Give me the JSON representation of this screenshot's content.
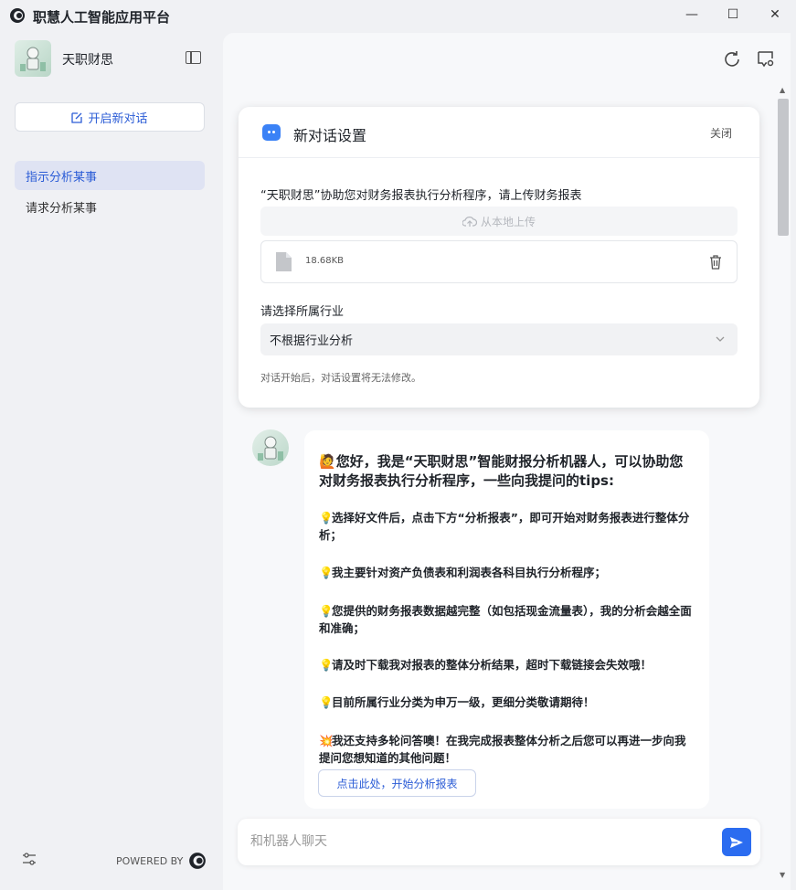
{
  "window": {
    "title": "职慧人工智能应用平台",
    "minimize_glyph": "—",
    "maximize_glyph": "☐",
    "close_glyph": "✕"
  },
  "sidebar": {
    "bot_name": "天职财思",
    "new_chat_label": "开启新对话",
    "items": [
      {
        "label": "指示分析某事",
        "active": true
      },
      {
        "label": "请求分析某事",
        "active": false
      }
    ],
    "powered_by": "POWERED BY"
  },
  "settings_card": {
    "title": "新对话设置",
    "close_label": "关闭",
    "upload_label": "“天职财思”协助您对财务报表执行分析程序，请上传财务报表",
    "upload_button": "从本地上传",
    "file_size": "18.68KB",
    "industry_label": "请选择所属行业",
    "industry_value": "不根据行业分析",
    "note": "对话开始后，对话设置将无法修改。"
  },
  "message": {
    "intro_emoji": "🙋",
    "intro": "您好，我是“天职财思”智能财报分析机器人，可以协助您对财务报表执行分析程序，一些向我提问的tips:",
    "tip_emoji": "💡",
    "tips": [
      "选择好文件后，点击下方“分析报表”，即可开始对财务报表进行整体分析；",
      "我主要针对资产负债表和利润表各科目执行分析程序；",
      "您提供的财务报表数据越完整（如包括现金流量表），我的分析会越全面和准确；",
      "请及时下载我对报表的整体分析结果，超时下载链接会失效哦！",
      "目前所属行业分类为申万一级，更细分类敬请期待！"
    ],
    "extra_emoji": "💥",
    "extra": "我还支持多轮问答噢！在我完成报表整体分析之后您可以再进一步向我提问您想知道的其他问题！",
    "start_button": "点击此处，开始分析报表"
  },
  "input": {
    "placeholder": "和机器人聊天",
    "value": ""
  },
  "colors": {
    "accent": "#2b5cd6",
    "send": "#2b6cf0",
    "sidebar_active": "#dfe3f3"
  }
}
